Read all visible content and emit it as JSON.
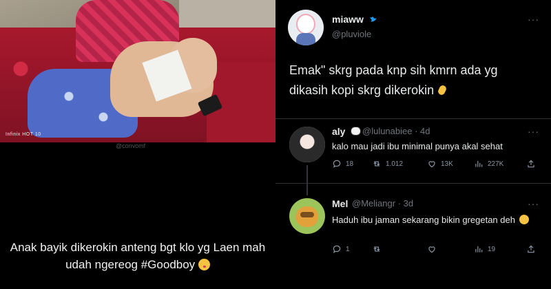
{
  "left": {
    "photo": {
      "brand_watermark": "Infinix HOT 10",
      "handle_watermark": "@convomf"
    },
    "caption": "Anak bayik dikerokin anteng bgt klo yg Laen mah udah ngereog #Goodboy"
  },
  "tweet": {
    "name": "miaww",
    "handle": "@pluviole",
    "text": "Emak\" skrg pada knp sih kmrn ada yg dikasih kopi skrg dikerokin"
  },
  "replies": [
    {
      "name": "aly",
      "handle": "@lulunabiee",
      "time": "4d",
      "text": "kalo mau jadi ibu minimal punya akal sehat",
      "reply_count": "18",
      "retweet_count": "1.012",
      "like_count": "13K",
      "view_count": "227K"
    },
    {
      "name": "Mel",
      "handle": "@Meliangr",
      "time": "3d",
      "text": "Haduh ibu jaman sekarang bikin gregetan deh",
      "reply_count": "1",
      "retweet_count": "",
      "like_count": "",
      "view_count": "19"
    }
  ],
  "icons": [
    "verified-icon",
    "more-icon",
    "reply-icon",
    "retweet-icon",
    "like-icon",
    "views-icon",
    "share-icon"
  ],
  "colors": {
    "background": "#000000",
    "text": "#e7e9ea",
    "muted": "#71767b",
    "divider": "#2f3336",
    "verified": "#1d9bf0"
  }
}
